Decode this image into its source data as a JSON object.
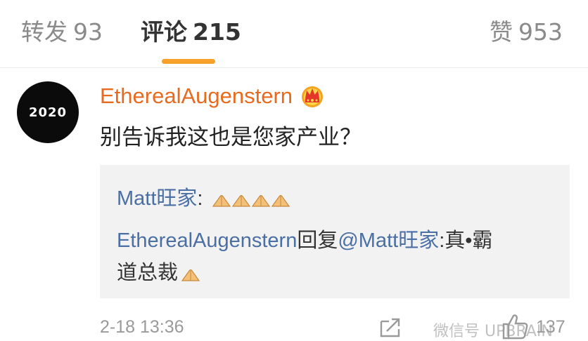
{
  "tabs": {
    "repost": {
      "label": "转发",
      "count": "93"
    },
    "comments": {
      "label": "评论",
      "count": "215"
    },
    "likes": {
      "label": "赞",
      "count": "953"
    }
  },
  "colors": {
    "accent": "#f7a02a",
    "username": "#e86a1f",
    "mention": "#4a6fa5"
  },
  "comment": {
    "avatar_text": "2020",
    "username": "EtherealAugenstern",
    "badge_icon": "vip-crown-icon",
    "text": "别告诉我这也是您家产业？",
    "replies": [
      {
        "author": "Matt旺家",
        "separator": ":",
        "emoji": "folded-hands-icon",
        "emoji_count": 4
      },
      {
        "author": "EtherealAugenstern",
        "action": "回复",
        "target": "@Matt旺家",
        "separator": ":",
        "text_line1": "真•霸",
        "text_line2": "道总裁",
        "emoji": "folded-hands-icon"
      }
    ],
    "time": "2-18 13:36",
    "like_count": "137"
  },
  "watermark": "微信号 UPBRAIN"
}
